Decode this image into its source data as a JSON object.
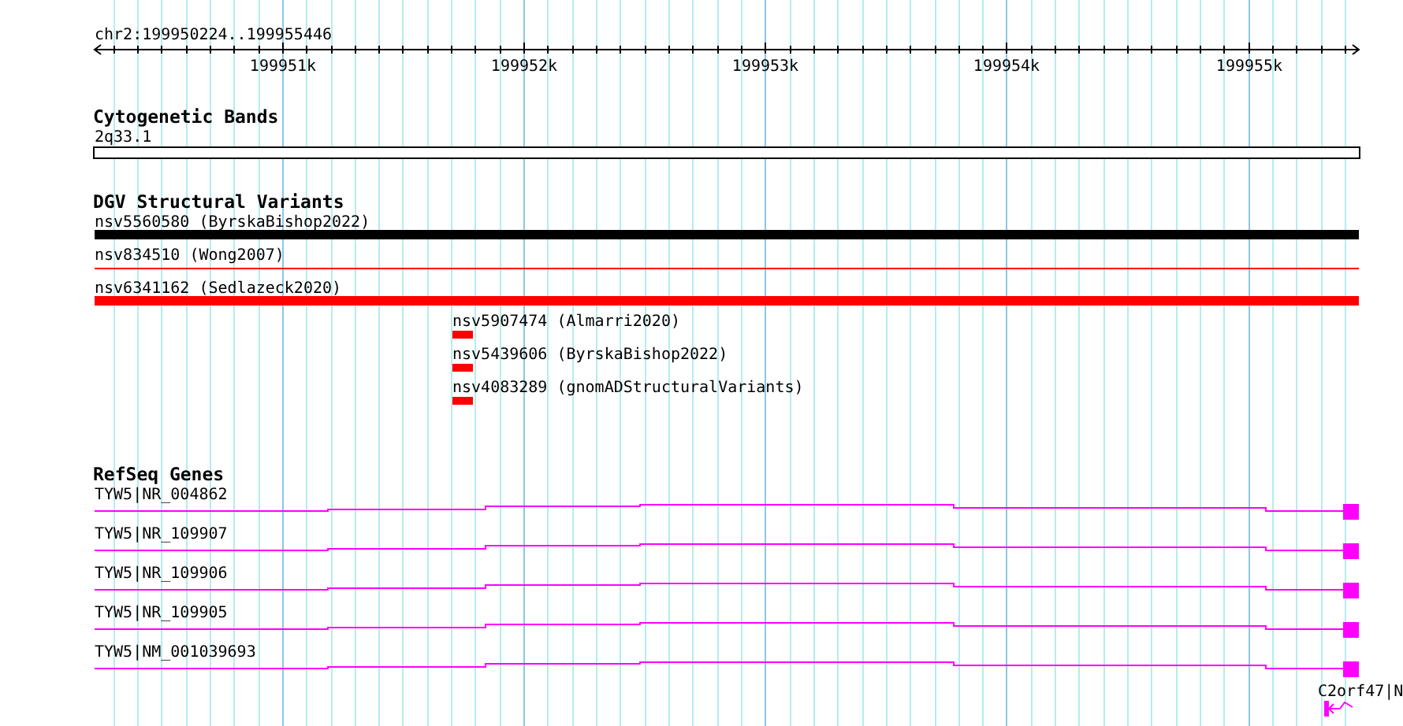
{
  "ruler": {
    "location": "chr2:199950224..199955446",
    "ticks": [
      "199951k",
      "199952k",
      "199953k",
      "199954k",
      "199955k"
    ]
  },
  "cytogenetic_bands": {
    "title": "Cytogenetic Bands",
    "features": [
      {
        "label": "2q33.1"
      }
    ]
  },
  "dgv_structural_variants": {
    "title": "DGV Structural Variants",
    "features": [
      {
        "label": "nsv5560580 (ByrskaBishop2022)",
        "kind": "thick",
        "color": "#000000"
      },
      {
        "label": "nsv834510 (Wong2007)",
        "kind": "line",
        "color": "#ff0000"
      },
      {
        "label": "nsv6341162 (Sedlazeck2020)",
        "kind": "thick",
        "color": "#ff0000"
      },
      {
        "label": "nsv5907474 (Almarri2020)",
        "kind": "small",
        "color": "#ff0000"
      },
      {
        "label": "nsv5439606 (ByrskaBishop2022)",
        "kind": "small",
        "color": "#ff0000"
      },
      {
        "label": "nsv4083289 (gnomADStructuralVariants)",
        "kind": "small",
        "color": "#ff0000"
      }
    ]
  },
  "refseq_genes": {
    "title": "RefSeq Genes",
    "features": [
      {
        "label": "TYW5|NR_004862",
        "kind": "transcript"
      },
      {
        "label": "TYW5|NR_109907",
        "kind": "transcript"
      },
      {
        "label": "TYW5|NR_109906",
        "kind": "transcript"
      },
      {
        "label": "TYW5|NR_109905",
        "kind": "transcript"
      },
      {
        "label": "TYW5|NM_001039693",
        "kind": "transcript"
      },
      {
        "label": "C2orf47|N",
        "kind": "partial"
      }
    ]
  }
}
